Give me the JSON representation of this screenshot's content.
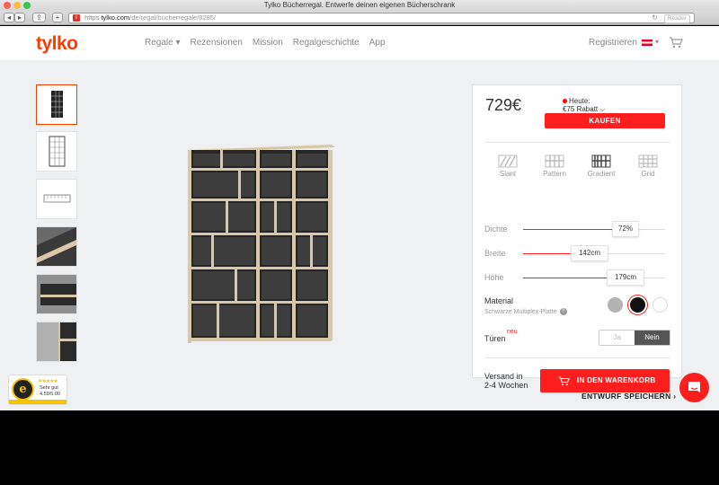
{
  "window": {
    "title": "Tylko Bücherregal. Entwerfe deinen eigenen Bücherschrank"
  },
  "browser": {
    "url_scheme": "https",
    "url_host": "tylko.com",
    "url_path": "/de/regal/bucherregale/8285/",
    "reader_label": "Reader",
    "new_tab_label": "+"
  },
  "nav": {
    "logo": "tylko",
    "items": [
      "Regale ▾",
      "Rezensionen",
      "Mission",
      "Regalgeschichte",
      "App"
    ],
    "register": "Registrieren",
    "flag_caret": "▾"
  },
  "config": {
    "price": "729€",
    "today_label": "Heute:",
    "discount": "€75 Rabatt ⌵",
    "buy_label": "KAUFEN",
    "styles": [
      "Slant",
      "Pattern",
      "Gradient",
      "Grid"
    ],
    "selected_style": "Gradient",
    "sliders": [
      {
        "label": "Dichte",
        "value_text": "72%",
        "fill": 0.72
      },
      {
        "label": "Breite",
        "value_text": "142cm",
        "fill": 0.47
      },
      {
        "label": "Höhe",
        "value_text": "179cm",
        "fill": 0.72
      }
    ],
    "material_label": "Material",
    "material_sub": "Schwarze Multiplex-Platte",
    "swatch_colors": [
      "#b3b3b3",
      "#111111",
      "#ffffff"
    ],
    "selected_swatch": 1,
    "doors_label": "Türen",
    "doors_new": "neu",
    "doors_options": [
      "Ja",
      "Nein"
    ],
    "doors_selected": "Nein",
    "shipping": [
      "Versand in",
      "2-4 Wochen"
    ],
    "cart_label": "IN DEN WARENKORB",
    "save_label": "ENTWURF SPEICHERN ›"
  },
  "trust_badge": {
    "stars": "★★★★★",
    "rating_text": "Sehr gut",
    "score": "4.59/5.00"
  },
  "colors": {
    "brand": "#ff3c00",
    "accent": "#ff1e1e"
  }
}
